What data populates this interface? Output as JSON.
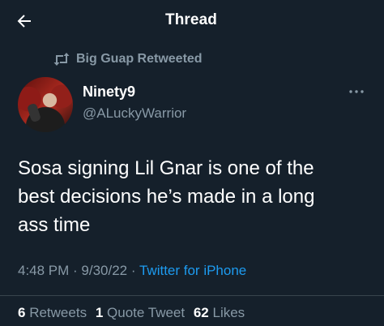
{
  "header": {
    "title": "Thread"
  },
  "retweet": {
    "label": "Big Guap Retweeted"
  },
  "author": {
    "name": "Ninety9",
    "handle": "@ALuckyWarrior"
  },
  "tweet": {
    "text_line1": "Sosa signing Lil Gnar is one of the",
    "text_line2": "best decisions he’s made in a long",
    "text_line3": "ass time"
  },
  "meta": {
    "time": "4:48 PM",
    "sep1": " · ",
    "date": "9/30/22",
    "sep2": " · ",
    "source": "Twitter for iPhone"
  },
  "stats": {
    "retweets_count": "6",
    "retweets_label": "Retweets",
    "quotes_count": "1",
    "quotes_label": "Quote Tweet",
    "likes_count": "62",
    "likes_label": "Likes"
  },
  "icons": {
    "back": "arrow-left-icon",
    "retweet": "retweet-icon",
    "more": "more-icon"
  },
  "colors": {
    "background": "#15202b",
    "secondary_text": "#8899a6",
    "link": "#1d9bf0"
  }
}
